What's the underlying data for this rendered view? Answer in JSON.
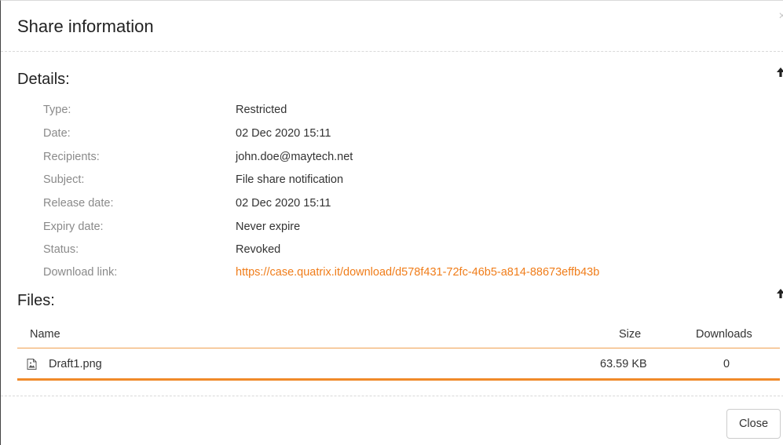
{
  "dialog": {
    "title": "Share information",
    "close_glyph": "×"
  },
  "details": {
    "heading": "Details:",
    "rows": [
      {
        "label": "Type:",
        "value": "Restricted"
      },
      {
        "label": "Date:",
        "value": "02 Dec 2020 15:11"
      },
      {
        "label": "Recipients:",
        "value": "john.doe@maytech.net"
      },
      {
        "label": "Subject:",
        "value": "File share notification"
      },
      {
        "label": "Release date:",
        "value": "02 Dec 2020 15:11"
      },
      {
        "label": "Expiry date:",
        "value": "Never expire"
      },
      {
        "label": "Status:",
        "value": "Revoked"
      },
      {
        "label": "Download link:",
        "value": "https://case.quatrix.it/download/d578f431-72fc-46b5-a814-88673effb43b"
      }
    ]
  },
  "files": {
    "heading": "Files:",
    "columns": {
      "name": "Name",
      "size": "Size",
      "downloads": "Downloads"
    },
    "rows": [
      {
        "name": "Draft1.png",
        "size": "63.59 KB",
        "downloads": "0",
        "icon": "image-file-icon"
      }
    ]
  },
  "footer": {
    "close_label": "Close"
  },
  "colors": {
    "accent": "#f07d1a",
    "label_gray": "#8a8a8a"
  }
}
